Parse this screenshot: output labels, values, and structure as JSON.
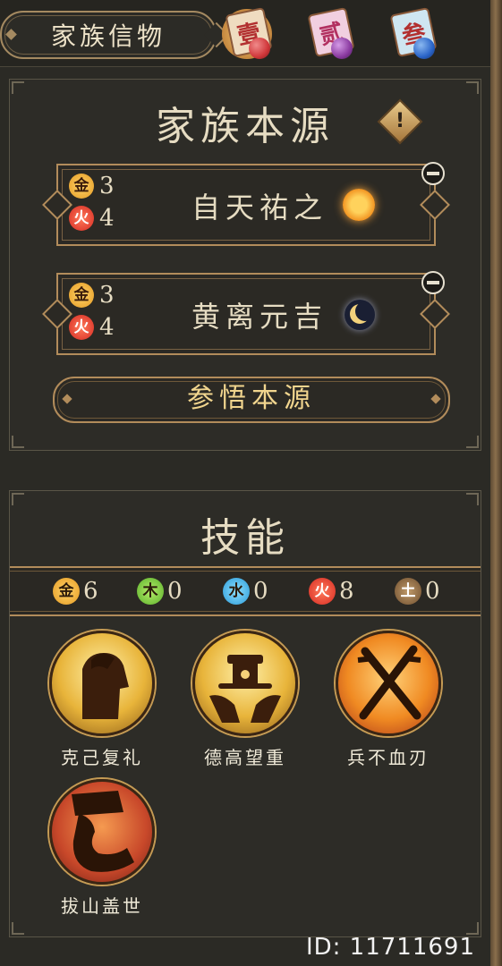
{
  "top_tabs": {
    "title": "家族信物",
    "tabs": [
      {
        "label": "壹",
        "ball_color": "#d0373a",
        "active": true
      },
      {
        "label": "贰",
        "ball_color": "#8a3aa0",
        "active": false
      },
      {
        "label": "叁",
        "ball_color": "#2a64c8",
        "active": false
      }
    ]
  },
  "source_panel": {
    "title": "家族本源",
    "warning_symbol": "!",
    "sources": [
      {
        "elements": [
          {
            "symbol": "金",
            "count": "3"
          },
          {
            "symbol": "火",
            "count": "4"
          }
        ],
        "name": "自天祐之",
        "icon": "sun-icon"
      },
      {
        "elements": [
          {
            "symbol": "金",
            "count": "3"
          },
          {
            "symbol": "火",
            "count": "4"
          }
        ],
        "name": "黄离元吉",
        "icon": "moon-icon"
      }
    ],
    "comprehend_button": "参悟本源"
  },
  "skills_panel": {
    "title": "技能",
    "element_counts": [
      {
        "symbol": "金",
        "count": "6",
        "color": "#f2b33a"
      },
      {
        "symbol": "木",
        "count": "0",
        "color": "#6fbf3a"
      },
      {
        "symbol": "水",
        "count": "0",
        "color": "#3aa6e0"
      },
      {
        "symbol": "火",
        "count": "8",
        "color": "#e0342a"
      },
      {
        "symbol": "土",
        "count": "0",
        "color": "#8a6a44"
      }
    ],
    "skills": [
      {
        "name": "克己复礼",
        "icon": "bowing-figure-icon"
      },
      {
        "name": "德高望重",
        "icon": "hands-holding-hat-icon"
      },
      {
        "name": "兵不血刃",
        "icon": "crossed-swords-icon"
      },
      {
        "name": "拔山盖世",
        "icon": "arm-lifting-stone-icon"
      }
    ]
  },
  "uid": "ID: 11711691"
}
